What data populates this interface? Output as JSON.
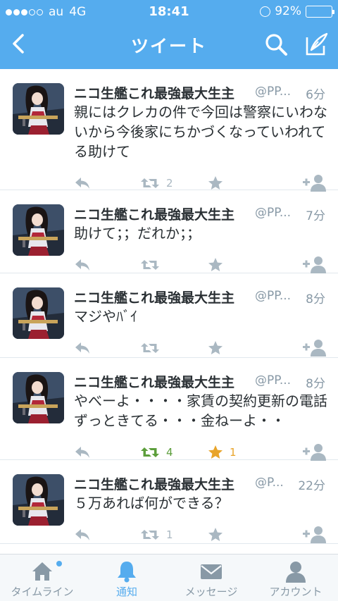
{
  "status": {
    "carrier": "au",
    "network": "4G",
    "time": "18:41",
    "battery": "92%"
  },
  "nav": {
    "title": "ツイート"
  },
  "colors": {
    "header": "#55acee",
    "retweeted": "#5c9e3b",
    "favorited": "#e8a42a",
    "muted": "#aab8c2"
  },
  "tweets": [
    {
      "name": "ニコ生艦これ最強最大生主",
      "handle": "@PP...",
      "time": "6分",
      "text": "親にはクレカの件で今回は警察にいわないから今後家にちかづくなっていわれてる助けて",
      "retweets": "2",
      "favorites": ""
    },
    {
      "name": "ニコ生艦これ最強最大生主",
      "handle": "@PP...",
      "time": "7分",
      "text": "助けて；；だれか；；",
      "retweets": "",
      "favorites": ""
    },
    {
      "name": "ニコ生艦これ最強最大生主",
      "handle": "@PP...",
      "time": "8分",
      "text": "マジやﾊﾞｲ",
      "retweets": "",
      "favorites": ""
    },
    {
      "name": "ニコ生艦これ最強最大生主",
      "handle": "@PP...",
      "time": "8分",
      "text": "やべーよ・・・・家賃の契約更新の電話ずっときてる・・・金ねーよ・・",
      "retweets": "4",
      "favorites": "1"
    },
    {
      "name": "ニコ生艦これ最強最大生主",
      "handle": "@P...",
      "time": "22分",
      "text": "５万あれば何ができる？",
      "retweets": "1",
      "favorites": ""
    }
  ],
  "tabs": [
    {
      "label": "タイムライン",
      "icon": "home-icon",
      "active": false,
      "badge": true
    },
    {
      "label": "通知",
      "icon": "bell-icon",
      "active": true,
      "badge": false
    },
    {
      "label": "メッセージ",
      "icon": "envelope-icon",
      "active": false,
      "badge": false
    },
    {
      "label": "アカウント",
      "icon": "person-icon",
      "active": false,
      "badge": false
    }
  ]
}
